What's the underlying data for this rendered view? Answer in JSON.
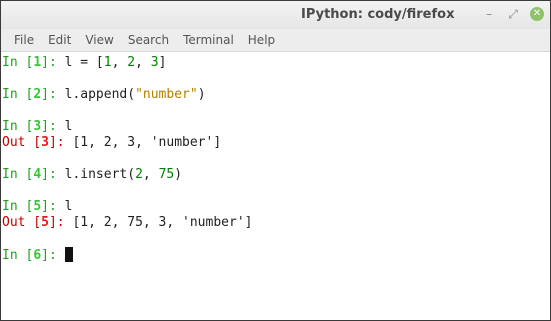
{
  "window": {
    "title": "IPython: cody/firefox",
    "controls": [
      "minimize-icon",
      "maximize-icon",
      "close-icon"
    ],
    "minimize_glyph": "–",
    "maximize_glyph": "⤢",
    "close_glyph": "✕"
  },
  "menubar": {
    "items": [
      "File",
      "Edit",
      "View",
      "Search",
      "Terminal",
      "Help"
    ]
  },
  "colors": {
    "in_prompt": "#1ea51e",
    "out_prompt": "#c10000",
    "string": "#b08000",
    "number_literal": "#008000"
  },
  "terminal": {
    "in_label": "In",
    "out_label": "Out",
    "cells": [
      {
        "kind": "in",
        "n": "1",
        "code": [
          "l = [",
          {
            "num": "1"
          },
          ", ",
          {
            "num": "2"
          },
          ", ",
          {
            "num": "3"
          },
          "]"
        ]
      },
      {
        "kind": "in",
        "n": "2",
        "code": [
          "l.append(",
          {
            "str": "\"number\""
          },
          ")"
        ]
      },
      {
        "kind": "in",
        "n": "3",
        "code": [
          "l"
        ]
      },
      {
        "kind": "out",
        "n": "3",
        "code": [
          "[1, 2, 3, 'number']"
        ]
      },
      {
        "kind": "in",
        "n": "4",
        "code": [
          "l.insert(",
          {
            "num": "2"
          },
          ", ",
          {
            "num": "75"
          },
          ")"
        ]
      },
      {
        "kind": "in",
        "n": "5",
        "code": [
          "l"
        ]
      },
      {
        "kind": "out",
        "n": "5",
        "code": [
          "[1, 2, 75, 3, 'number']"
        ]
      },
      {
        "kind": "in",
        "n": "6",
        "code": []
      }
    ]
  }
}
